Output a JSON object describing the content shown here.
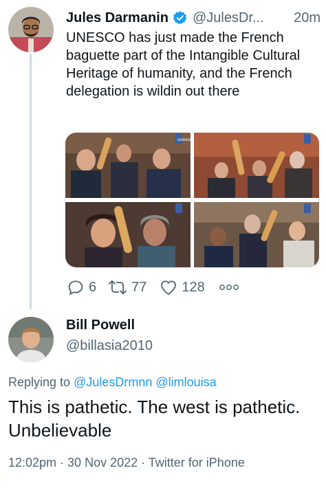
{
  "tweet": {
    "author_name": "Jules Darmanin",
    "handle": "@JulesDr...",
    "time": "20m",
    "text": "UNESCO has just made the French baguette part of the Intangible Cultural Heritage of humanity, and the French delegation is wildin out there",
    "media_watermark": "unesco",
    "actions": {
      "replies": "6",
      "retweets": "77",
      "likes": "128"
    }
  },
  "reply": {
    "author_name": "Bill Powell",
    "handle": "@billasia2010",
    "replying_prefix": "Replying to",
    "mentions": [
      "@JulesDrmnn",
      "@limlouisa"
    ],
    "text": "This is pathetic. The west is pathetic. Unbelievable",
    "timestamp": "12:02pm · 30 Nov 2022 · Twitter for iPhone"
  },
  "colors": {
    "accent": "#1d9bf0",
    "secondary_text": "#536471",
    "thread_line": "#cfd9de"
  }
}
